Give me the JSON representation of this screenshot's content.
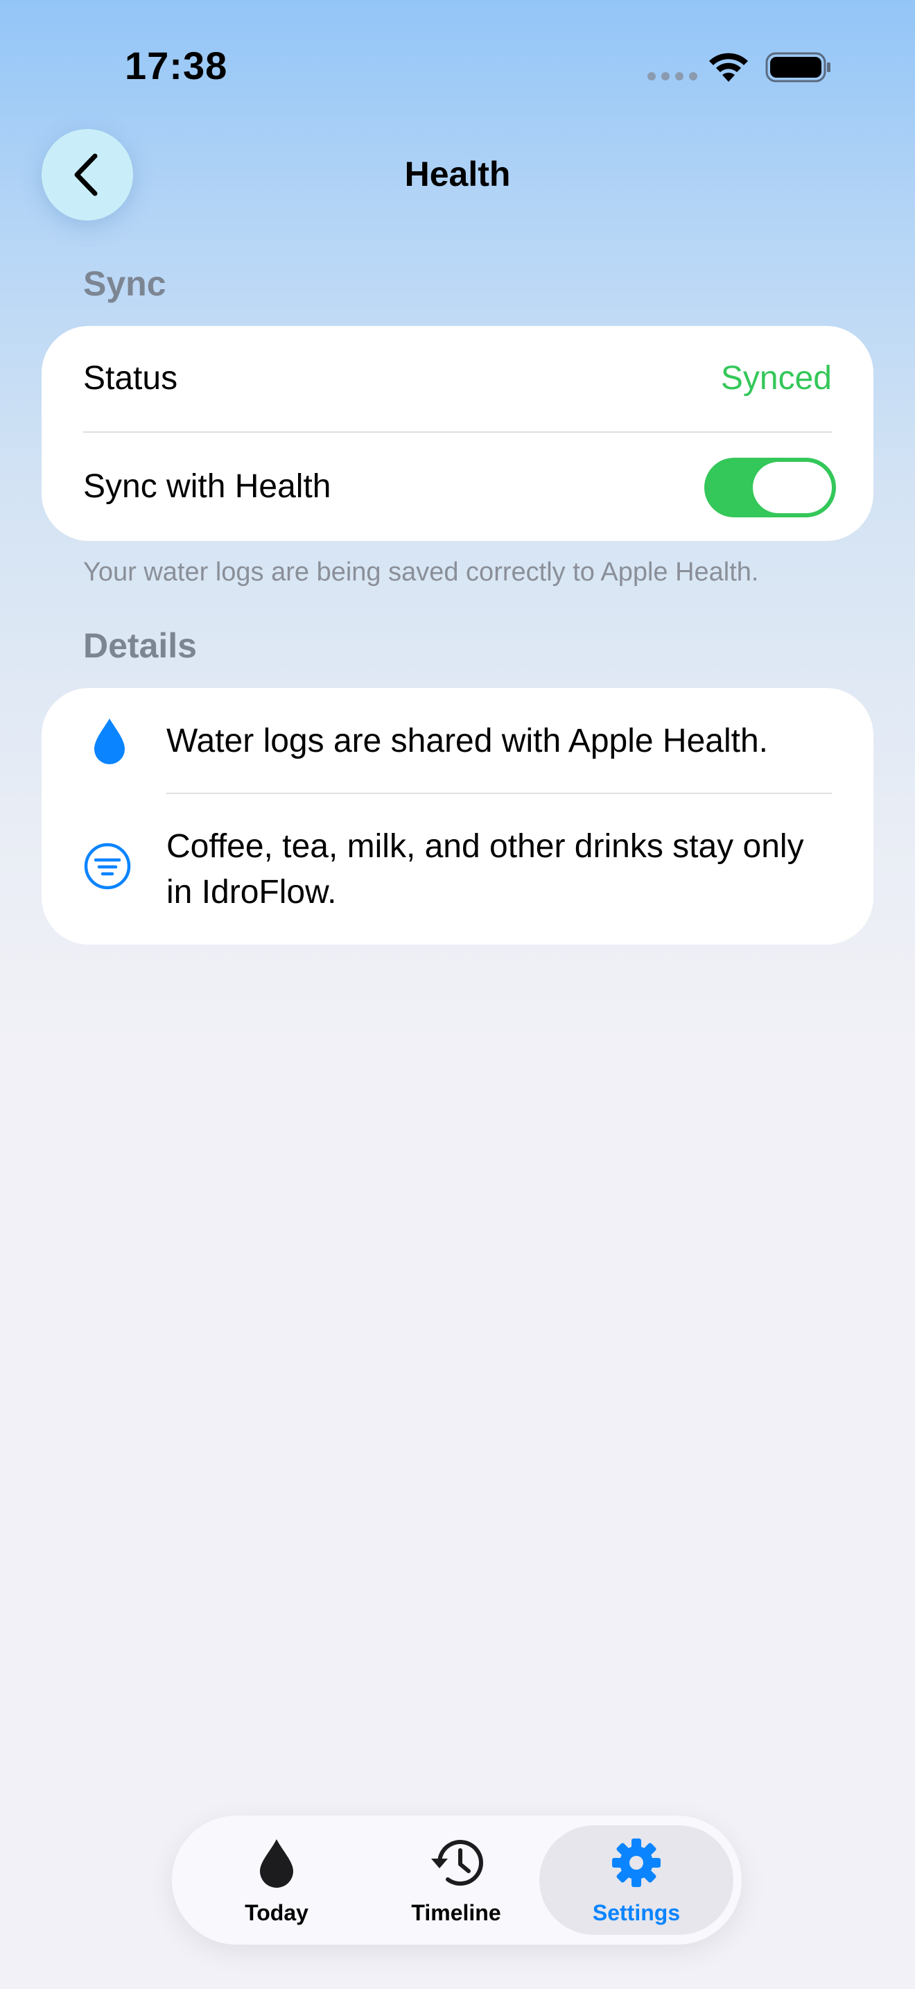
{
  "status_bar": {
    "time": "17:38"
  },
  "nav": {
    "title": "Health"
  },
  "sync_section": {
    "header": "Sync",
    "status_label": "Status",
    "status_value": "Synced",
    "toggle_label": "Sync with Health",
    "toggle_on": true,
    "footnote": "Your water logs are being saved correctly to Apple Health."
  },
  "details_section": {
    "header": "Details",
    "items": [
      {
        "icon": "water-drop-icon",
        "text": "Water logs are shared with Apple Health."
      },
      {
        "icon": "filter-circle-icon",
        "text": "Coffee, tea, milk, and other drinks stay only in IdroFlow."
      }
    ]
  },
  "tab_bar": {
    "tabs": [
      {
        "label": "Today",
        "icon": "drop-icon",
        "selected": false
      },
      {
        "label": "Timeline",
        "icon": "history-clock-icon",
        "selected": false
      },
      {
        "label": "Settings",
        "icon": "gear-icon",
        "selected": true
      }
    ]
  },
  "colors": {
    "accent": "#0a84ff",
    "synced_green": "#34c759",
    "toggle_green": "#34c759",
    "secondary_text": "#7c8592"
  }
}
